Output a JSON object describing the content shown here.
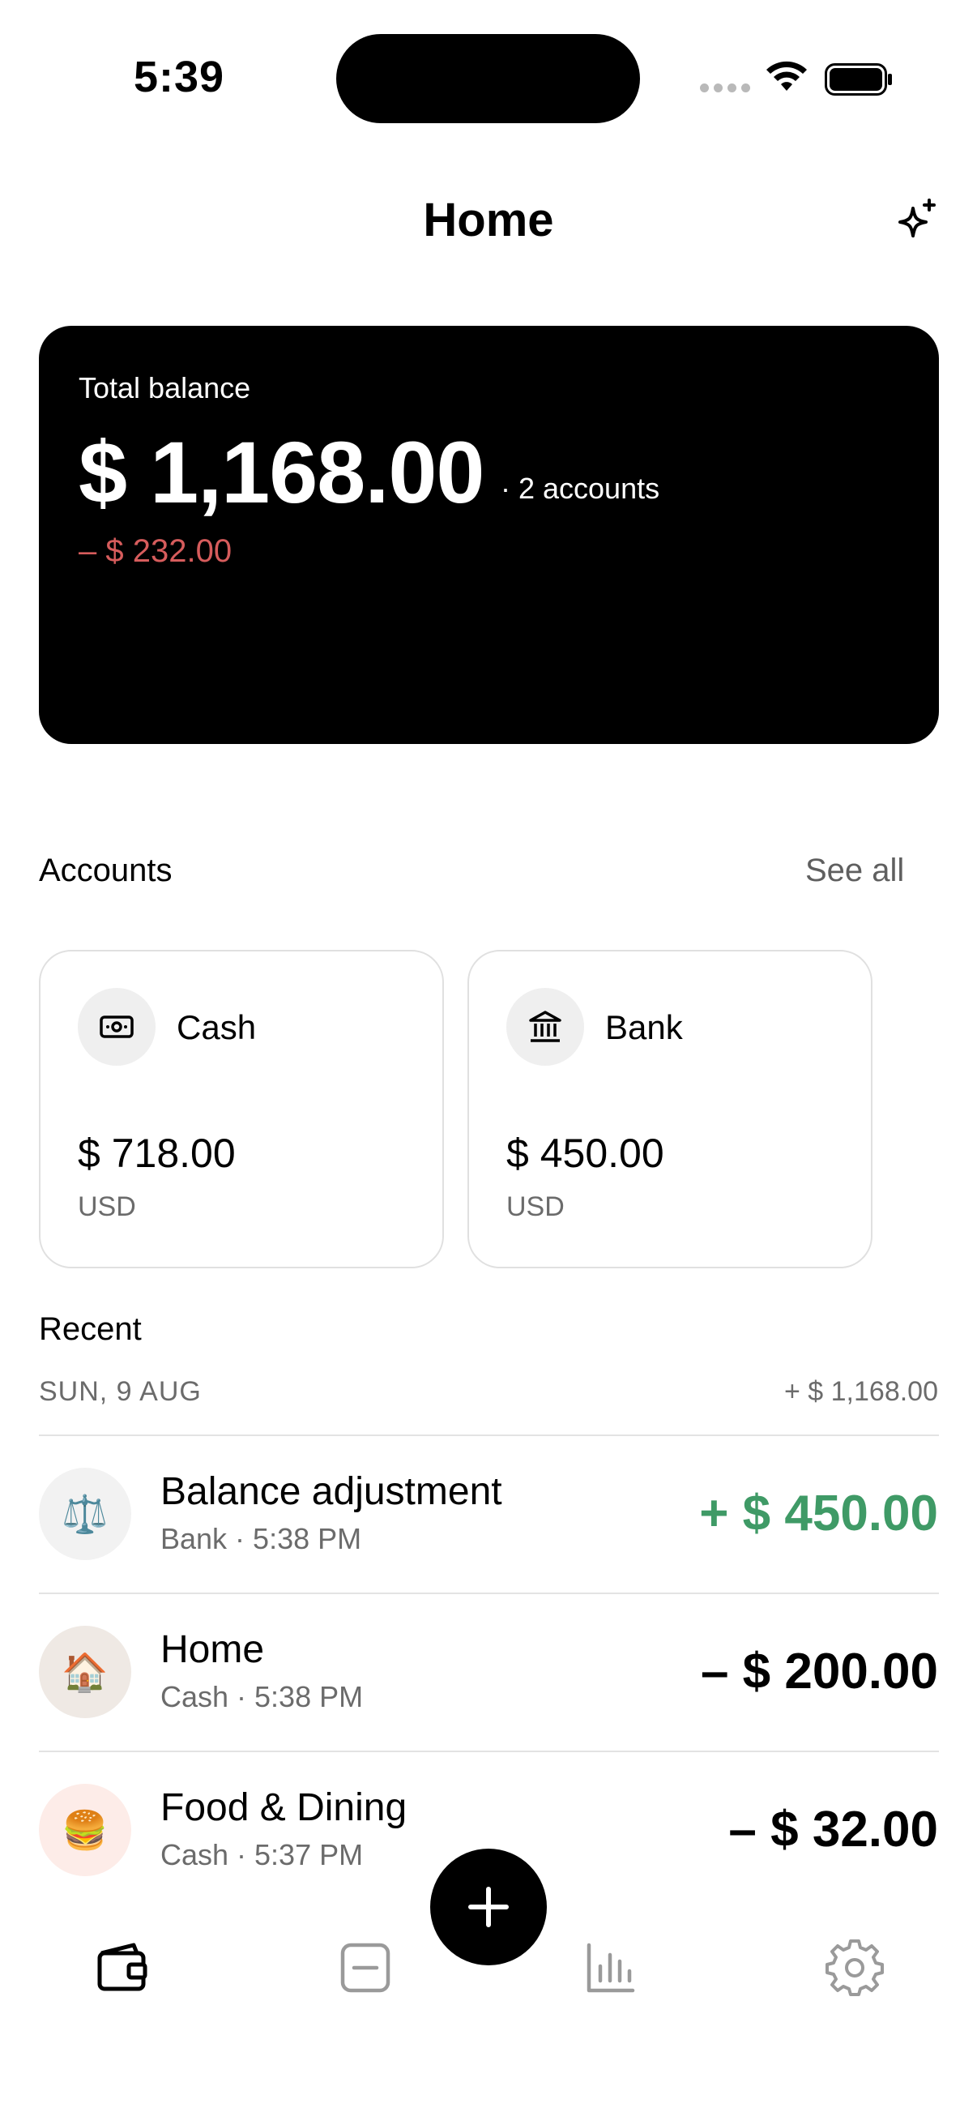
{
  "status_bar": {
    "time": "5:39"
  },
  "header": {
    "title": "Home",
    "action_icon": "sparkle-icon"
  },
  "balance_card": {
    "label": "Total balance",
    "amount": "$ 1,168.00",
    "accounts_note": "· 2 accounts",
    "change": "– $ 232.00",
    "change_color": "#d65c5c"
  },
  "accounts": {
    "title": "Accounts",
    "see_all": "See all",
    "items": [
      {
        "icon": "cash-icon",
        "name": "Cash",
        "balance": "$ 718.00",
        "currency": "USD"
      },
      {
        "icon": "bank-icon",
        "name": "Bank",
        "balance": "$ 450.00",
        "currency": "USD"
      }
    ]
  },
  "recent": {
    "title": "Recent",
    "day_label": "SUN, 9 AUG",
    "day_total": "+ $ 1,168.00",
    "transactions": [
      {
        "icon": "⚖️",
        "icon_name": "scale-icon",
        "title": "Balance adjustment",
        "subtitle": "Bank · 5:38 PM",
        "amount": "+ $ 450.00",
        "type": "income"
      },
      {
        "icon": "🏠",
        "icon_name": "house-icon",
        "title": "Home",
        "subtitle": "Cash · 5:38 PM",
        "amount": "– $ 200.00",
        "type": "expense"
      },
      {
        "icon": "🍔",
        "icon_name": "burger-icon",
        "title": "Food & Dining",
        "subtitle": "Cash · 5:37 PM",
        "amount": "– $ 32.00",
        "type": "expense"
      }
    ]
  },
  "tab_bar": {
    "tabs": [
      "wallet-icon",
      "minus-square-icon",
      "bar-chart-icon",
      "gear-icon"
    ],
    "active": "wallet-icon",
    "fab_icon": "plus-icon"
  },
  "colors": {
    "income": "#3f9a66",
    "expense": "#000000",
    "muted": "#6b6b6b",
    "inactive_tab": "#9a9a9a"
  }
}
